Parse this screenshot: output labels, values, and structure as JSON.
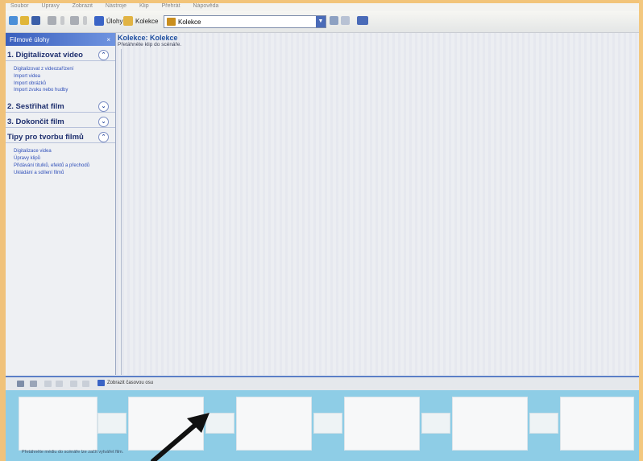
{
  "menu": [
    "Soubor",
    "Úpravy",
    "Zobrazit",
    "Nástroje",
    "Klip",
    "Přehrát",
    "Nápověda"
  ],
  "toolbar": {
    "tasks_label": "Úlohy",
    "collections_label": "Kolekce",
    "collection_select": "Kolekce"
  },
  "taskpane": {
    "title": "Filmové úlohy",
    "close": "×",
    "sections": [
      {
        "title": "1. Digitalizovat video",
        "chevron": "⌃",
        "links": [
          "Digitalizovat z videozařízení",
          "Import videa",
          "Import obrázků",
          "Import zvuku nebo hudby"
        ]
      },
      {
        "title": "2. Sestřihat film",
        "chevron": "⌄",
        "links": []
      },
      {
        "title": "3. Dokončit film",
        "chevron": "⌄",
        "links": []
      },
      {
        "title": "Tipy pro tvorbu filmů",
        "chevron": "⌃",
        "links": [
          "Digitalizace videa",
          "Úpravy klipů",
          "Přidávání titulků, efektů a přechodů",
          "Ukládání a sdílení filmů"
        ]
      }
    ]
  },
  "content": {
    "title": "Kolekce: Kolekce",
    "subtitle": "Přetáhněte klip do scénáře."
  },
  "storyboard": {
    "toolbar_label": "Zobrazit časovou osu",
    "hint": "Přetáhněte médiu do scénáře lze začít vytvářet film."
  },
  "colors": {
    "accent": "#3a5fbd",
    "storyboard_bg": "#8ecde6",
    "bezel": "#f2c47a"
  }
}
